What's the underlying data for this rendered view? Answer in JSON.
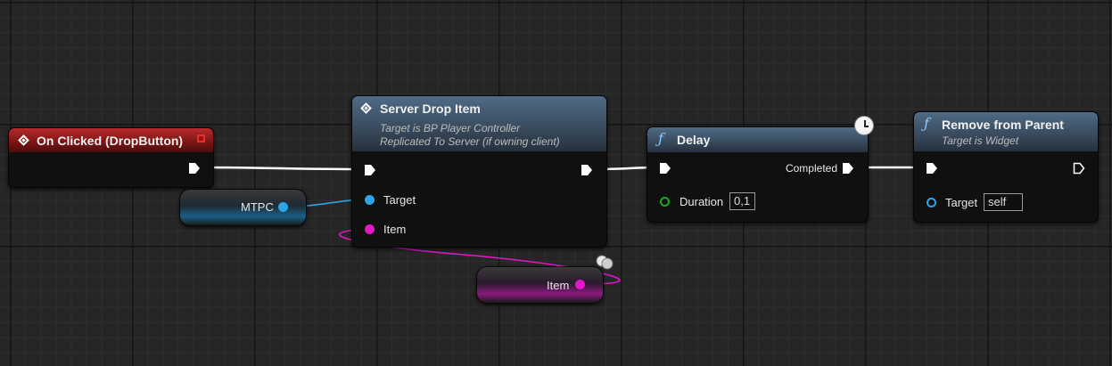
{
  "graph": {
    "nodes": {
      "on_clicked": {
        "title": "On Clicked (DropButton)"
      },
      "server_drop_item": {
        "title": "Server Drop Item",
        "subtitle_1": "Target is BP Player Controller",
        "subtitle_2": "Replicated To Server (if owning client)",
        "pin_target": "Target",
        "pin_item": "Item"
      },
      "delay": {
        "title": "Delay",
        "pin_completed": "Completed",
        "pin_duration": "Duration",
        "duration_value": "0,1"
      },
      "remove_from_parent": {
        "title": "Remove from Parent",
        "subtitle": "Target is Widget",
        "pin_target": "Target",
        "target_value": "self"
      }
    },
    "variables": {
      "mtpc": {
        "label": "MTPC"
      },
      "item": {
        "label": "Item"
      }
    }
  },
  "colors": {
    "exec_wire": "#ffffff",
    "object_wire": "#2ea4e8",
    "struct_wire": "#e316c8",
    "float_pin": "#1fa81f",
    "event_header": "#b72b2b",
    "function_header": "#4f6b86"
  },
  "icons": {
    "event": "event-diamond-icon",
    "function": "function-f-icon",
    "latent": "clock-icon",
    "replicated": "replication-icon"
  }
}
